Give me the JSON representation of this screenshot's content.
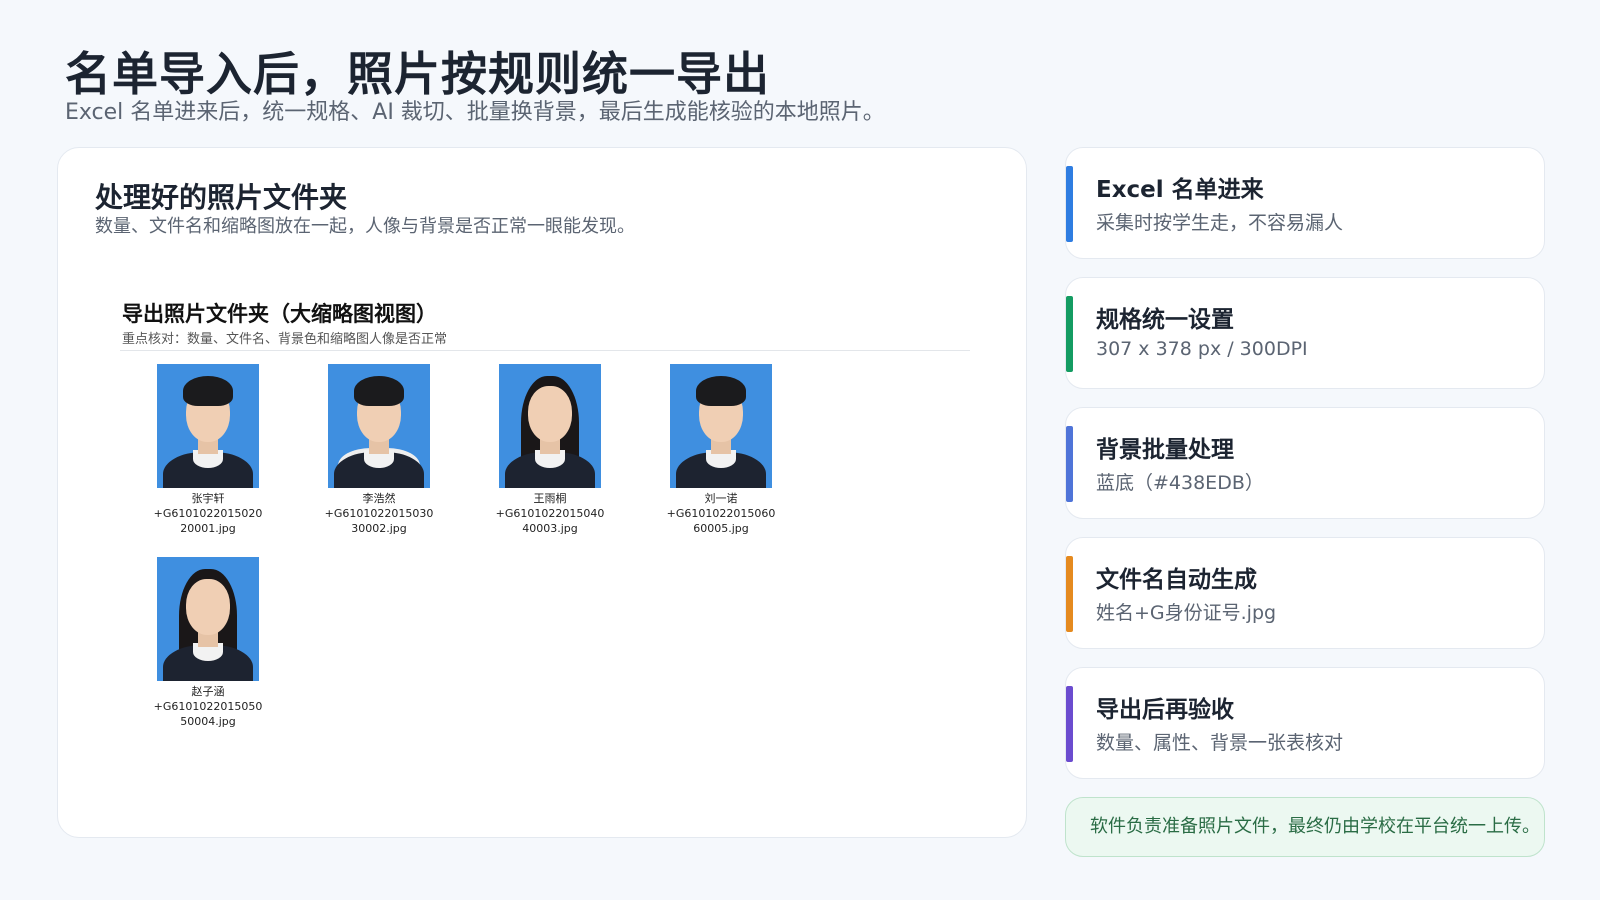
{
  "header": {
    "title": "名单导入后，照片按规则统一导出",
    "subtitle": "Excel 名单进来后，统一规格、AI 裁切、批量换背景，最后生成能核验的本地照片。"
  },
  "main": {
    "title": "处理好的照片文件夹",
    "desc": "数量、文件名和缩略图放在一起，人像与背景是否正常一眼能发现。",
    "folder": {
      "title": "导出照片文件夹（大缩略图视图）",
      "note": "重点核对：数量、文件名、背景色和缩略图人像是否正常",
      "files": [
        {
          "line1": "张宇轩",
          "line2": "+G6101022015020",
          "line3": "20001.jpg",
          "type": "male"
        },
        {
          "line1": "李浩然",
          "line2": "+G6101022015030",
          "line3": "30002.jpg",
          "type": "male-hood"
        },
        {
          "line1": "王雨桐",
          "line2": "+G6101022015040",
          "line3": "40003.jpg",
          "type": "female"
        },
        {
          "line1": "刘一诺",
          "line2": "+G6101022015060",
          "line3": "60005.jpg",
          "type": "male"
        },
        {
          "line1": "赵子涵",
          "line2": "+G6101022015050",
          "line3": "50004.jpg",
          "type": "female"
        }
      ]
    }
  },
  "side": [
    {
      "title": "Excel 名单进来",
      "desc": "采集时按学生走，不容易漏人",
      "color": "#2f7de1"
    },
    {
      "title": "规格统一设置",
      "desc": "307 x 378 px / 300DPI",
      "color": "#149c62"
    },
    {
      "title": "背景批量处理",
      "desc": "蓝底（#438EDB）",
      "color": "#4f74d8"
    },
    {
      "title": "文件名自动生成",
      "desc": "姓名+G身份证号.jpg",
      "color": "#e58a1f"
    },
    {
      "title": "导出后再验收",
      "desc": "数量、属性、背景一张表核对",
      "color": "#6b4ccf"
    }
  ],
  "footer_note": "软件负责准备照片文件，最终仍由学校在平台统一上传。"
}
